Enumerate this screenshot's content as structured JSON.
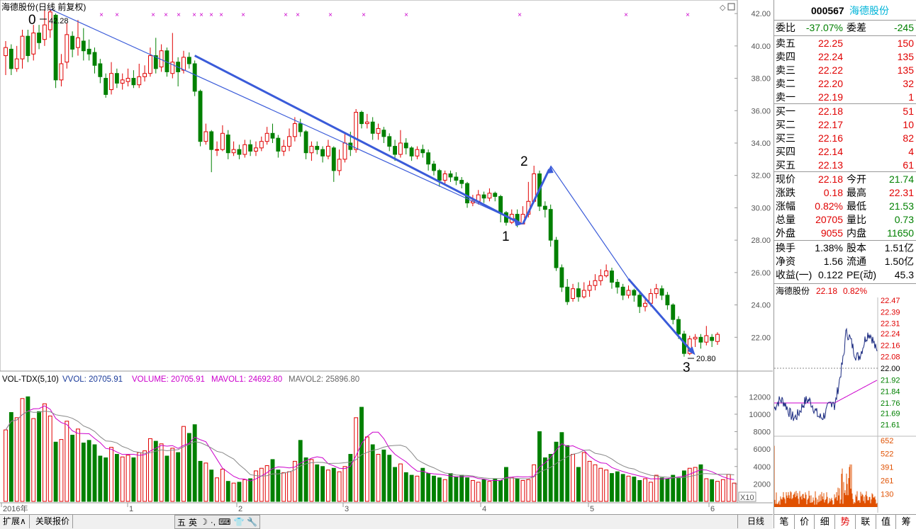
{
  "header": {
    "title": "海德股份(日线 前复权)"
  },
  "price_axis_labels": [
    "42.00",
    "40.00",
    "38.00",
    "36.00",
    "34.00",
    "32.00",
    "30.00",
    "28.00",
    "26.00",
    "24.00",
    "22.00"
  ],
  "annotations": {
    "wave0": "0",
    "wave1": "1",
    "wave2": "2",
    "wave3": "3",
    "high_label": "42.28",
    "low_label": "20.80"
  },
  "volume_header": {
    "name": "VOL-TDX(5,10)",
    "vvol": "VVOL: 20705.91",
    "volume": "VOLUME: 20705.91",
    "mavol1": "MAVOL1: 24692.80",
    "mavol2": "MAVOL2: 25896.80"
  },
  "volume_axis_labels": [
    "12000",
    "10000",
    "8000",
    "6000",
    "4000",
    "2000"
  ],
  "volume_unit": "X10",
  "time_axis": [
    "2016年",
    "1",
    "2",
    "3",
    "4",
    "5",
    "6"
  ],
  "bottom_tabs": {
    "expand": "扩展∧",
    "related": "关联报价",
    "period": "日线"
  },
  "toolbar_items": [
    "五",
    "英",
    "☽",
    "·,",
    "⌨",
    "👕",
    "🔧"
  ],
  "quote": {
    "code": "000567",
    "name": "海德股份",
    "weibi_label": "委比",
    "weibi": "-37.07%",
    "weicha_label": "委差",
    "weicha": "-245",
    "asks": [
      {
        "label": "卖五",
        "price": "22.25",
        "vol": "150"
      },
      {
        "label": "卖四",
        "price": "22.24",
        "vol": "135"
      },
      {
        "label": "卖三",
        "price": "22.22",
        "vol": "135"
      },
      {
        "label": "卖二",
        "price": "22.20",
        "vol": "32"
      },
      {
        "label": "卖一",
        "price": "22.19",
        "vol": "1"
      }
    ],
    "bids": [
      {
        "label": "买一",
        "price": "22.18",
        "vol": "51"
      },
      {
        "label": "买二",
        "price": "22.17",
        "vol": "10"
      },
      {
        "label": "买三",
        "price": "22.16",
        "vol": "82"
      },
      {
        "label": "买四",
        "price": "22.14",
        "vol": "4"
      },
      {
        "label": "买五",
        "price": "22.13",
        "vol": "61"
      }
    ],
    "stats1": [
      {
        "l1": "现价",
        "v1": "22.18",
        "c1": "red",
        "l2": "今开",
        "v2": "21.74",
        "c2": "green"
      },
      {
        "l1": "涨跌",
        "v1": "0.18",
        "c1": "red",
        "l2": "最高",
        "v2": "22.31",
        "c2": "red"
      },
      {
        "l1": "涨幅",
        "v1": "0.82%",
        "c1": "red",
        "l2": "最低",
        "v2": "21.53",
        "c2": "green"
      },
      {
        "l1": "总量",
        "v1": "20705",
        "c1": "red",
        "l2": "量比",
        "v2": "0.73",
        "c2": "green"
      },
      {
        "l1": "外盘",
        "v1": "9055",
        "c1": "red",
        "l2": "内盘",
        "v2": "11650",
        "c2": "green"
      }
    ],
    "stats2": [
      {
        "l1": "换手",
        "v1": "1.38%",
        "l2": "股本",
        "v2": "1.51亿"
      },
      {
        "l1": "净资",
        "v1": "1.56",
        "l2": "流通",
        "v2": "1.50亿"
      },
      {
        "l1": "收益(一)",
        "v1": "0.122",
        "l2": "PE(动)",
        "v2": "45.3"
      }
    ],
    "mini_title": "海德股份",
    "mini_price": "22.18",
    "mini_pct": "0.82%",
    "mini_axis": [
      "22.47",
      "22.39",
      "22.31",
      "22.24",
      "22.16",
      "22.08",
      "22.00",
      "21.92",
      "21.84",
      "21.76",
      "21.69",
      "21.61"
    ],
    "mini_vol_axis": [
      "652",
      "522",
      "391",
      "261",
      "130"
    ],
    "tabs": [
      "笔",
      "价",
      "细",
      "势",
      "联",
      "值",
      "筹"
    ],
    "active_tab": "势"
  },
  "chart_data": {
    "type": "candlestick",
    "note_series": "daily OHLC approximated from the chart",
    "candles": [
      [
        39.4,
        39.9,
        38.2,
        40.3
      ],
      [
        39.8,
        38.6,
        38.2,
        40.1
      ],
      [
        38.6,
        39.2,
        38.4,
        40.0
      ],
      [
        39.2,
        40.6,
        38.6,
        41.0
      ],
      [
        40.6,
        39.4,
        39.0,
        41.0
      ],
      [
        39.5,
        40.8,
        39.1,
        41.3
      ],
      [
        40.8,
        40.2,
        39.8,
        41.3
      ],
      [
        40.4,
        41.3,
        40.0,
        42.2
      ],
      [
        41.0,
        42.1,
        40.5,
        42.28
      ],
      [
        41.9,
        37.9,
        37.4,
        42.0
      ],
      [
        37.9,
        38.9,
        37.5,
        39.5
      ],
      [
        39.0,
        40.7,
        38.6,
        41.4
      ],
      [
        40.6,
        39.8,
        39.3,
        40.9
      ],
      [
        39.9,
        40.5,
        39.4,
        41.6
      ],
      [
        40.3,
        39.7,
        39.1,
        41.1
      ],
      [
        39.8,
        39.5,
        39.1,
        40.4
      ],
      [
        39.6,
        38.8,
        38.3,
        39.9
      ],
      [
        38.9,
        38.1,
        37.7,
        39.2
      ],
      [
        38.0,
        37.0,
        36.8,
        38.3
      ],
      [
        37.3,
        38.3,
        37.0,
        39.0
      ],
      [
        38.3,
        37.7,
        37.4,
        38.6
      ],
      [
        37.7,
        37.9,
        37.3,
        38.3
      ],
      [
        37.8,
        38.0,
        37.5,
        38.6
      ],
      [
        38.0,
        37.6,
        37.4,
        38.5
      ],
      [
        37.6,
        38.1,
        37.4,
        38.9
      ],
      [
        38.1,
        38.3,
        37.8,
        38.8
      ],
      [
        38.3,
        39.4,
        38.1,
        39.9
      ],
      [
        39.4,
        38.6,
        38.3,
        40.5
      ],
      [
        38.7,
        39.7,
        38.4,
        40.1
      ],
      [
        39.7,
        38.4,
        38.1,
        39.9
      ],
      [
        38.3,
        39.0,
        38.0,
        40.8
      ],
      [
        39.0,
        38.4,
        37.5,
        39.3
      ],
      [
        38.5,
        39.3,
        38.3,
        39.7
      ],
      [
        39.3,
        38.9,
        38.6,
        39.6
      ],
      [
        38.9,
        37.2,
        36.9,
        39.1
      ],
      [
        37.2,
        34.1,
        33.8,
        37.3
      ],
      [
        34.1,
        34.7,
        33.9,
        35.2
      ],
      [
        34.7,
        33.6,
        32.2,
        34.8
      ],
      [
        33.6,
        33.6,
        33.2,
        34.1
      ],
      [
        33.6,
        34.6,
        33.5,
        35.1
      ],
      [
        34.5,
        33.4,
        33.0,
        34.8
      ],
      [
        33.4,
        33.6,
        33.2,
        34.1
      ],
      [
        33.6,
        33.3,
        33.0,
        33.9
      ],
      [
        33.3,
        33.9,
        33.1,
        34.2
      ],
      [
        33.9,
        33.5,
        33.2,
        34.2
      ],
      [
        33.5,
        33.7,
        33.2,
        34.1
      ],
      [
        33.7,
        34.1,
        33.5,
        34.4
      ],
      [
        34.1,
        34.6,
        33.9,
        35.0
      ],
      [
        34.6,
        34.3,
        34.0,
        35.2
      ],
      [
        34.3,
        33.5,
        33.1,
        34.5
      ],
      [
        33.5,
        33.8,
        33.2,
        34.2
      ],
      [
        33.8,
        34.4,
        33.5,
        34.9
      ],
      [
        34.4,
        35.2,
        34.1,
        35.6
      ],
      [
        35.2,
        34.7,
        34.4,
        35.5
      ],
      [
        34.7,
        33.4,
        33.0,
        34.8
      ],
      [
        33.4,
        33.8,
        32.9,
        34.1
      ],
      [
        33.8,
        33.6,
        33.3,
        34.1
      ],
      [
        33.6,
        33.2,
        32.8,
        33.8
      ],
      [
        33.2,
        33.8,
        33.0,
        34.2
      ],
      [
        33.7,
        32.3,
        31.6,
        33.8
      ],
      [
        32.3,
        33.0,
        32.0,
        33.6
      ],
      [
        33.0,
        34.0,
        32.8,
        34.6
      ],
      [
        34.0,
        33.6,
        33.2,
        34.7
      ],
      [
        33.6,
        35.9,
        33.4,
        36.1
      ],
      [
        35.9,
        35.2,
        34.9,
        36.0
      ],
      [
        35.2,
        35.3,
        34.9,
        35.8
      ],
      [
        35.3,
        34.6,
        34.2,
        35.6
      ],
      [
        34.6,
        34.9,
        34.2,
        35.2
      ],
      [
        34.8,
        34.4,
        34.0,
        35.0
      ],
      [
        34.4,
        33.8,
        33.5,
        34.6
      ],
      [
        33.8,
        33.3,
        32.9,
        34.2
      ],
      [
        33.3,
        34.0,
        33.1,
        34.8
      ],
      [
        34.0,
        33.7,
        33.3,
        34.3
      ],
      [
        33.7,
        33.2,
        32.9,
        33.8
      ],
      [
        33.2,
        33.6,
        33.0,
        33.8
      ],
      [
        33.6,
        33.4,
        33.1,
        33.9
      ],
      [
        33.4,
        32.7,
        32.3,
        33.6
      ],
      [
        32.7,
        32.3,
        32.0,
        32.9
      ],
      [
        32.3,
        31.7,
        31.3,
        32.4
      ],
      [
        31.7,
        32.1,
        31.5,
        32.3
      ],
      [
        32.1,
        31.9,
        31.6,
        32.3
      ],
      [
        31.9,
        31.7,
        31.4,
        32.2
      ],
      [
        31.7,
        31.5,
        31.2,
        31.9
      ],
      [
        31.5,
        30.3,
        30.0,
        31.6
      ],
      [
        30.3,
        30.4,
        30.1,
        30.8
      ],
      [
        30.4,
        30.8,
        30.2,
        31.1
      ],
      [
        30.8,
        30.6,
        30.3,
        31.0
      ],
      [
        30.6,
        30.9,
        30.4,
        31.2
      ],
      [
        30.9,
        30.7,
        30.4,
        31.0
      ],
      [
        30.7,
        29.7,
        29.1,
        30.8
      ],
      [
        29.7,
        29.1,
        28.9,
        29.8
      ],
      [
        29.1,
        29.6,
        29.0,
        29.9
      ],
      [
        29.6,
        29.0,
        28.8,
        29.9
      ],
      [
        29.0,
        29.6,
        29.0,
        30.1
      ],
      [
        29.6,
        30.4,
        29.4,
        31.6
      ],
      [
        30.4,
        32.1,
        30.3,
        32.6
      ],
      [
        32.1,
        30.1,
        29.8,
        32.3
      ],
      [
        30.1,
        29.9,
        29.4,
        30.4
      ],
      [
        29.9,
        28.0,
        27.6,
        30.2
      ],
      [
        28.0,
        26.3,
        26.1,
        28.2
      ],
      [
        26.3,
        25.1,
        24.8,
        26.5
      ],
      [
        25.1,
        24.2,
        24.0,
        25.6
      ],
      [
        24.4,
        25.0,
        24.2,
        25.3
      ],
      [
        25.0,
        24.5,
        24.2,
        25.4
      ],
      [
        24.5,
        24.9,
        24.4,
        25.4
      ],
      [
        24.9,
        25.2,
        24.5,
        25.5
      ],
      [
        25.2,
        25.5,
        24.9,
        25.9
      ],
      [
        25.5,
        25.8,
        25.2,
        26.2
      ],
      [
        25.8,
        26.1,
        25.7,
        26.5
      ],
      [
        26.1,
        25.4,
        25.0,
        26.3
      ],
      [
        25.4,
        25.1,
        24.7,
        25.6
      ],
      [
        25.1,
        24.6,
        24.3,
        25.3
      ],
      [
        24.6,
        24.9,
        24.4,
        25.2
      ],
      [
        24.9,
        24.6,
        24.2,
        25.0
      ],
      [
        24.6,
        23.9,
        23.5,
        24.8
      ],
      [
        23.9,
        24.1,
        23.6,
        24.4
      ],
      [
        24.1,
        24.7,
        23.9,
        25.0
      ],
      [
        24.7,
        25.0,
        24.4,
        25.3
      ],
      [
        25.0,
        24.6,
        24.3,
        25.2
      ],
      [
        24.6,
        24.0,
        23.7,
        24.8
      ],
      [
        24.0,
        23.1,
        22.8,
        24.1
      ],
      [
        23.1,
        22.2,
        21.9,
        23.3
      ],
      [
        22.2,
        21.0,
        20.8,
        22.4
      ],
      [
        21.0,
        21.9,
        20.9,
        22.1
      ],
      [
        21.9,
        22.0,
        21.4,
        22.2
      ],
      [
        22.0,
        21.7,
        21.3,
        22.2
      ],
      [
        21.7,
        22.1,
        21.5,
        22.7
      ],
      [
        22.0,
        21.8,
        21.4,
        22.2
      ],
      [
        21.74,
        22.18,
        21.53,
        22.31
      ]
    ],
    "volumes": [
      8200,
      10200,
      9600,
      11800,
      12000,
      9500,
      10300,
      11200,
      9800,
      6800,
      7100,
      9200,
      7600,
      8300,
      6700,
      7000,
      6500,
      5200,
      5000,
      6200,
      5400,
      5100,
      5300,
      5000,
      5600,
      5800,
      7200,
      6900,
      6600,
      5200,
      6100,
      5600,
      8600,
      7800,
      8800,
      4600,
      4400,
      3600,
      2700,
      3700,
      2300,
      2100,
      2200,
      2500,
      2600,
      3500,
      3800,
      4100,
      4800,
      3600,
      3300,
      3400,
      4600,
      7000,
      5000,
      4800,
      4200,
      4000,
      3600,
      3800,
      3400,
      4000,
      5400,
      9600,
      10800,
      7400,
      6500,
      5400,
      5900,
      5300,
      3900,
      4300,
      3300,
      3000,
      2900,
      3800,
      3200,
      2900,
      2700,
      2500,
      3200,
      2800,
      3000,
      2700,
      2400,
      2200,
      2500,
      2300,
      2600,
      2400,
      3900,
      2700,
      2600,
      2400,
      2500,
      4200,
      8000,
      5000,
      5400,
      6800,
      7900,
      6400,
      5400,
      3900,
      5600,
      4600,
      4200,
      3800,
      3600,
      3200,
      3400,
      3100,
      2900,
      2800,
      2400,
      2600,
      2200,
      3000,
      2700,
      2600,
      3000,
      2700,
      3500,
      3800,
      3900,
      4200,
      2600,
      2500,
      2300,
      2500,
      3100,
      2100
    ]
  }
}
